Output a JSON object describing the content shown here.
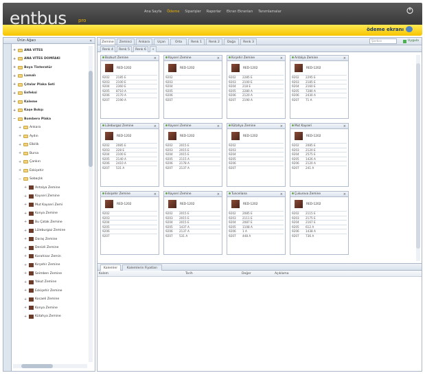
{
  "app": {
    "logo": "entbus",
    "logo_sub": "pro",
    "account_label": "ödeme ekranı",
    "nav": [
      "Ana Sayfa",
      "Ödeme",
      "Siparişler",
      "Raporlar",
      "Ekran Ekranları",
      "Tanımlamalar"
    ],
    "active_nav_index": 1
  },
  "left_panel": {
    "title": "Ürün Ağacı",
    "tree": [
      {
        "label": "ANA VİTES",
        "level": 1,
        "icon": "folder"
      },
      {
        "label": "ANA VİTES DOMFAKI",
        "level": 1,
        "icon": "folder"
      },
      {
        "label": "Boya Tinteratür",
        "level": 1,
        "icon": "folder"
      },
      {
        "label": "Lamalı",
        "level": 1,
        "icon": "folder"
      },
      {
        "label": "Çıtalar Plaka Seti",
        "level": 1,
        "icon": "folder"
      },
      {
        "label": "Enfeksi",
        "level": 1,
        "icon": "folder"
      },
      {
        "label": "Kaleme",
        "level": 1,
        "icon": "folder"
      },
      {
        "label": "Kaşe Bokşı",
        "level": 1,
        "icon": "folder"
      },
      {
        "label": "Bombero Plaka",
        "level": 1,
        "icon": "folder",
        "toggle": "−"
      },
      {
        "label": "Ankara",
        "level": 2,
        "icon": "folder"
      },
      {
        "label": "Aydın",
        "level": 2,
        "icon": "folder"
      },
      {
        "label": "Elbilik",
        "level": 2,
        "icon": "folder"
      },
      {
        "label": "Bursa",
        "level": 2,
        "icon": "folder"
      },
      {
        "label": "Çankırı",
        "level": 2,
        "icon": "folder"
      },
      {
        "label": "Eskişehir",
        "level": 2,
        "icon": "folder"
      },
      {
        "label": "Sobaçlık",
        "level": 2,
        "icon": "folder",
        "toggle": "−"
      },
      {
        "label": "Antalya Zemine",
        "level": 3,
        "icon": "product"
      },
      {
        "label": "Kayseri Zemine",
        "level": 3,
        "icon": "product"
      },
      {
        "label": "Mut Kayseri Zemi",
        "level": 3,
        "icon": "product"
      },
      {
        "label": "Konya Zemine",
        "level": 3,
        "icon": "product"
      },
      {
        "label": "Bu Çatak Zemine",
        "level": 3,
        "icon": "product"
      },
      {
        "label": "Lüleburgaz Zemine",
        "level": 3,
        "icon": "product"
      },
      {
        "label": "Daraş Zemine",
        "level": 3,
        "icon": "product"
      },
      {
        "label": "Denizli Zemine",
        "level": 3,
        "icon": "product"
      },
      {
        "label": "Karahisar Zemin",
        "level": 3,
        "icon": "product"
      },
      {
        "label": "Kırşehir Zemine",
        "level": 3,
        "icon": "product"
      },
      {
        "label": "Seimben Zemine",
        "level": 3,
        "icon": "product"
      },
      {
        "label": "Yakut Zemine",
        "level": 3,
        "icon": "product"
      },
      {
        "label": "Eskişehir Zemine",
        "level": 3,
        "icon": "product"
      },
      {
        "label": "Kocaeli Zemine",
        "level": 3,
        "icon": "product"
      },
      {
        "label": "Konya Zemine",
        "level": 3,
        "icon": "product"
      },
      {
        "label": "Kütahya Zemine",
        "level": 3,
        "icon": "product"
      }
    ]
  },
  "right_panel": {
    "tabs_row1": [
      "Zemine",
      "Zeminci",
      "Ankara",
      "Uçan",
      "Orta",
      "Renk 1",
      "Renk 2",
      "Doğa",
      "Renk 3"
    ],
    "tabs_row2": [
      "Renk 4",
      "Renk 5",
      "Renk 6",
      "+"
    ],
    "search_placeholder": "Şarkısı",
    "apply_label": "Uygula",
    "cards": [
      {
        "title": "Bozkurt Zemine",
        "code": "RED-1202",
        "rows": [
          [
            "9202",
            "2185 E"
          ],
          [
            "9203",
            "2100 E"
          ],
          [
            "9204",
            "2360 E"
          ],
          [
            "9205",
            "8710 A"
          ],
          [
            "9206",
            "2170 A"
          ],
          [
            "9207",
            "2190 A"
          ]
        ]
      },
      {
        "title": "Kayseri Zemine",
        "code": "RED-1202",
        "rows": [
          [
            "9202",
            ""
          ],
          [
            "9203",
            ""
          ],
          [
            "9204",
            ""
          ],
          [
            "9205",
            ""
          ],
          [
            "9206",
            ""
          ],
          [
            "9207",
            ""
          ]
        ]
      },
      {
        "title": "Kırşehir Zemine",
        "code": "RED-1202",
        "rows": [
          [
            "9202",
            "2285 E"
          ],
          [
            "9203",
            "2100 E"
          ],
          [
            "9204",
            "218 E"
          ],
          [
            "9205",
            "2280 A"
          ],
          [
            "9206",
            "2120 A"
          ],
          [
            "9207",
            "2190 A"
          ]
        ]
      },
      {
        "title": "Antalya Zemine",
        "code": "RED-1202",
        "rows": [
          [
            "9202",
            "2295 E"
          ],
          [
            "9203",
            "2185 E"
          ],
          [
            "9204",
            "2160 E"
          ],
          [
            "9205",
            "7280 A"
          ],
          [
            "9206",
            "2430 A"
          ],
          [
            "9207",
            "71 A"
          ]
        ]
      },
      {
        "title": "Lüleburgaz Zemine",
        "code": "RED-1202",
        "rows": [
          [
            "9202",
            "2085 E"
          ],
          [
            "9203",
            "228 E"
          ],
          [
            "9204",
            "2100 E"
          ],
          [
            "9205",
            "2140 A"
          ],
          [
            "9206",
            "2410 A"
          ],
          [
            "9207",
            "531 A"
          ]
        ]
      },
      {
        "title": "Kayseri Zemine",
        "code": "RED-1202",
        "rows": [
          [
            "9202",
            "2015 E"
          ],
          [
            "9203",
            "2015 E"
          ],
          [
            "9204",
            "2015 E"
          ],
          [
            "9205",
            "2115 A"
          ],
          [
            "9206",
            "2178 A"
          ],
          [
            "9207",
            "2137 A"
          ]
        ]
      },
      {
        "title": "Kütahya Zemine",
        "code": "RED-1202",
        "rows": [
          [
            "9202",
            ""
          ],
          [
            "9203",
            ""
          ],
          [
            "9204",
            ""
          ],
          [
            "9205",
            ""
          ],
          [
            "9206",
            ""
          ],
          [
            "9207",
            ""
          ]
        ]
      },
      {
        "title": "Mut Kayseri",
        "code": "RED-1202",
        "rows": [
          [
            "9202",
            "2085 E"
          ],
          [
            "9203",
            "2120 E"
          ],
          [
            "9204",
            "2575 E"
          ],
          [
            "9205",
            "1426 A"
          ],
          [
            "9206",
            "2120 A"
          ],
          [
            "9207",
            "241 A"
          ]
        ]
      },
      {
        "title": "Eskişehir Zemine",
        "code": "RED-1202",
        "rows": [
          [
            "9202",
            ""
          ],
          [
            "9203",
            ""
          ],
          [
            "9204",
            ""
          ],
          [
            "9205",
            ""
          ],
          [
            "9206",
            ""
          ],
          [
            "9207",
            ""
          ]
        ]
      },
      {
        "title": "Kayseri Zemine",
        "code": "RED-1202",
        "rows": [
          [
            "9202",
            "2015 E"
          ],
          [
            "9203",
            "2015 E"
          ],
          [
            "9204",
            "2015 E"
          ],
          [
            "9205",
            "1437 A"
          ],
          [
            "9206",
            "2137 A"
          ],
          [
            "9207",
            "531 A"
          ]
        ]
      },
      {
        "title": "Tunceliana",
        "code": "RED-1202",
        "rows": [
          [
            "9202",
            "2085 E"
          ],
          [
            "9203",
            "2111 E"
          ],
          [
            "9204",
            "2087 E"
          ],
          [
            "9205",
            "1108 A"
          ],
          [
            "9206",
            "1 A"
          ],
          [
            "9207",
            "448 A"
          ]
        ]
      },
      {
        "title": "Çukurova Zemine",
        "code": "RED-1202",
        "rows": [
          [
            "9202",
            "2115 E"
          ],
          [
            "9203",
            "2175 E"
          ],
          [
            "9204",
            "2167 E"
          ],
          [
            "9205",
            "612 A"
          ],
          [
            "9206",
            "1438 A"
          ],
          [
            "9207",
            "736 A"
          ]
        ]
      }
    ],
    "bottom_tabs": [
      "Kalemler",
      "Kalemlerin Fiyatları"
    ],
    "columns": [
      "Kalem",
      "Tarih",
      "Değer",
      "Açıklama"
    ]
  }
}
